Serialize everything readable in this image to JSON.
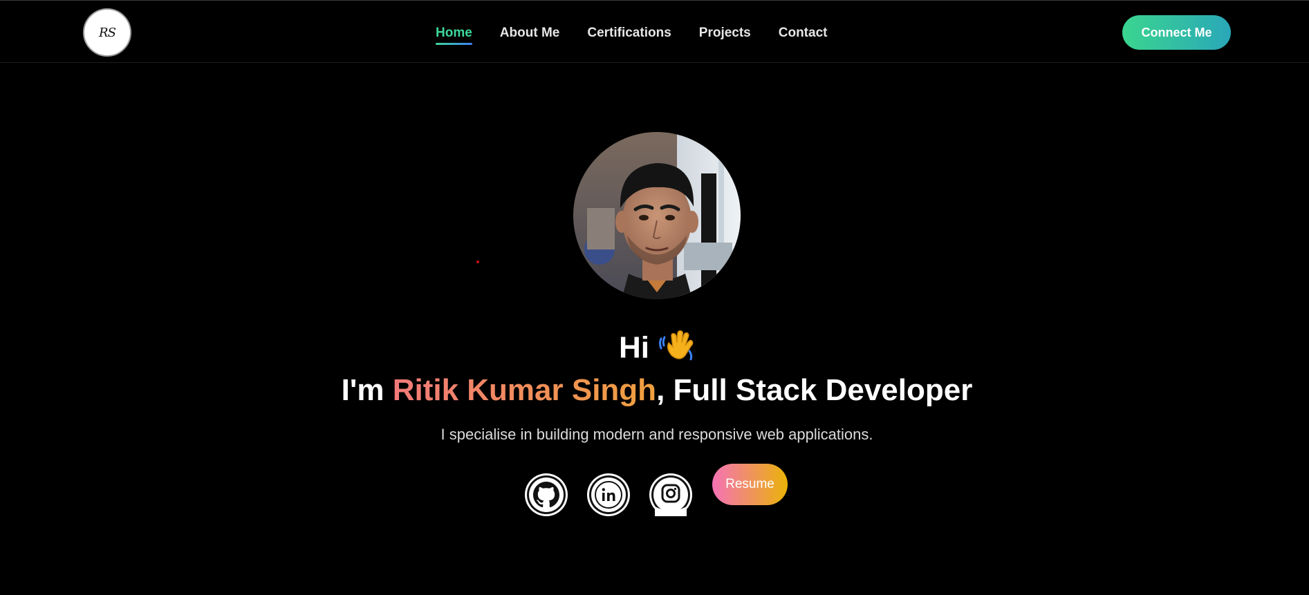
{
  "header": {
    "logo_text": "RS",
    "nav": [
      {
        "label": "Home",
        "active": true
      },
      {
        "label": "About Me",
        "active": false
      },
      {
        "label": "Certifications",
        "active": false
      },
      {
        "label": "Projects",
        "active": false
      },
      {
        "label": "Contact",
        "active": false
      }
    ],
    "connect_label": "Connect Me"
  },
  "hero": {
    "greeting": "Hi",
    "greeting_icon": "waving-hand-icon",
    "intro_prefix": "I'm ",
    "name": "Ritik Kumar Singh",
    "role": ", Full Stack Developer",
    "tagline": "I specialise in building modern and responsive web applications.",
    "socials": [
      {
        "name": "github",
        "icon": "github-icon"
      },
      {
        "name": "linkedin",
        "icon": "linkedin-icon"
      },
      {
        "name": "instagram",
        "icon": "instagram-icon"
      }
    ],
    "resume_label": "Resume"
  },
  "colors": {
    "background": "#000000",
    "nav_active": "#3fd69a",
    "connect_gradient": [
      "#3bd58f",
      "#2aa7b8"
    ],
    "name_gradient": [
      "#f27a7a",
      "#f0a03e"
    ],
    "resume_gradient": [
      "#f472b6",
      "#eab308"
    ]
  }
}
